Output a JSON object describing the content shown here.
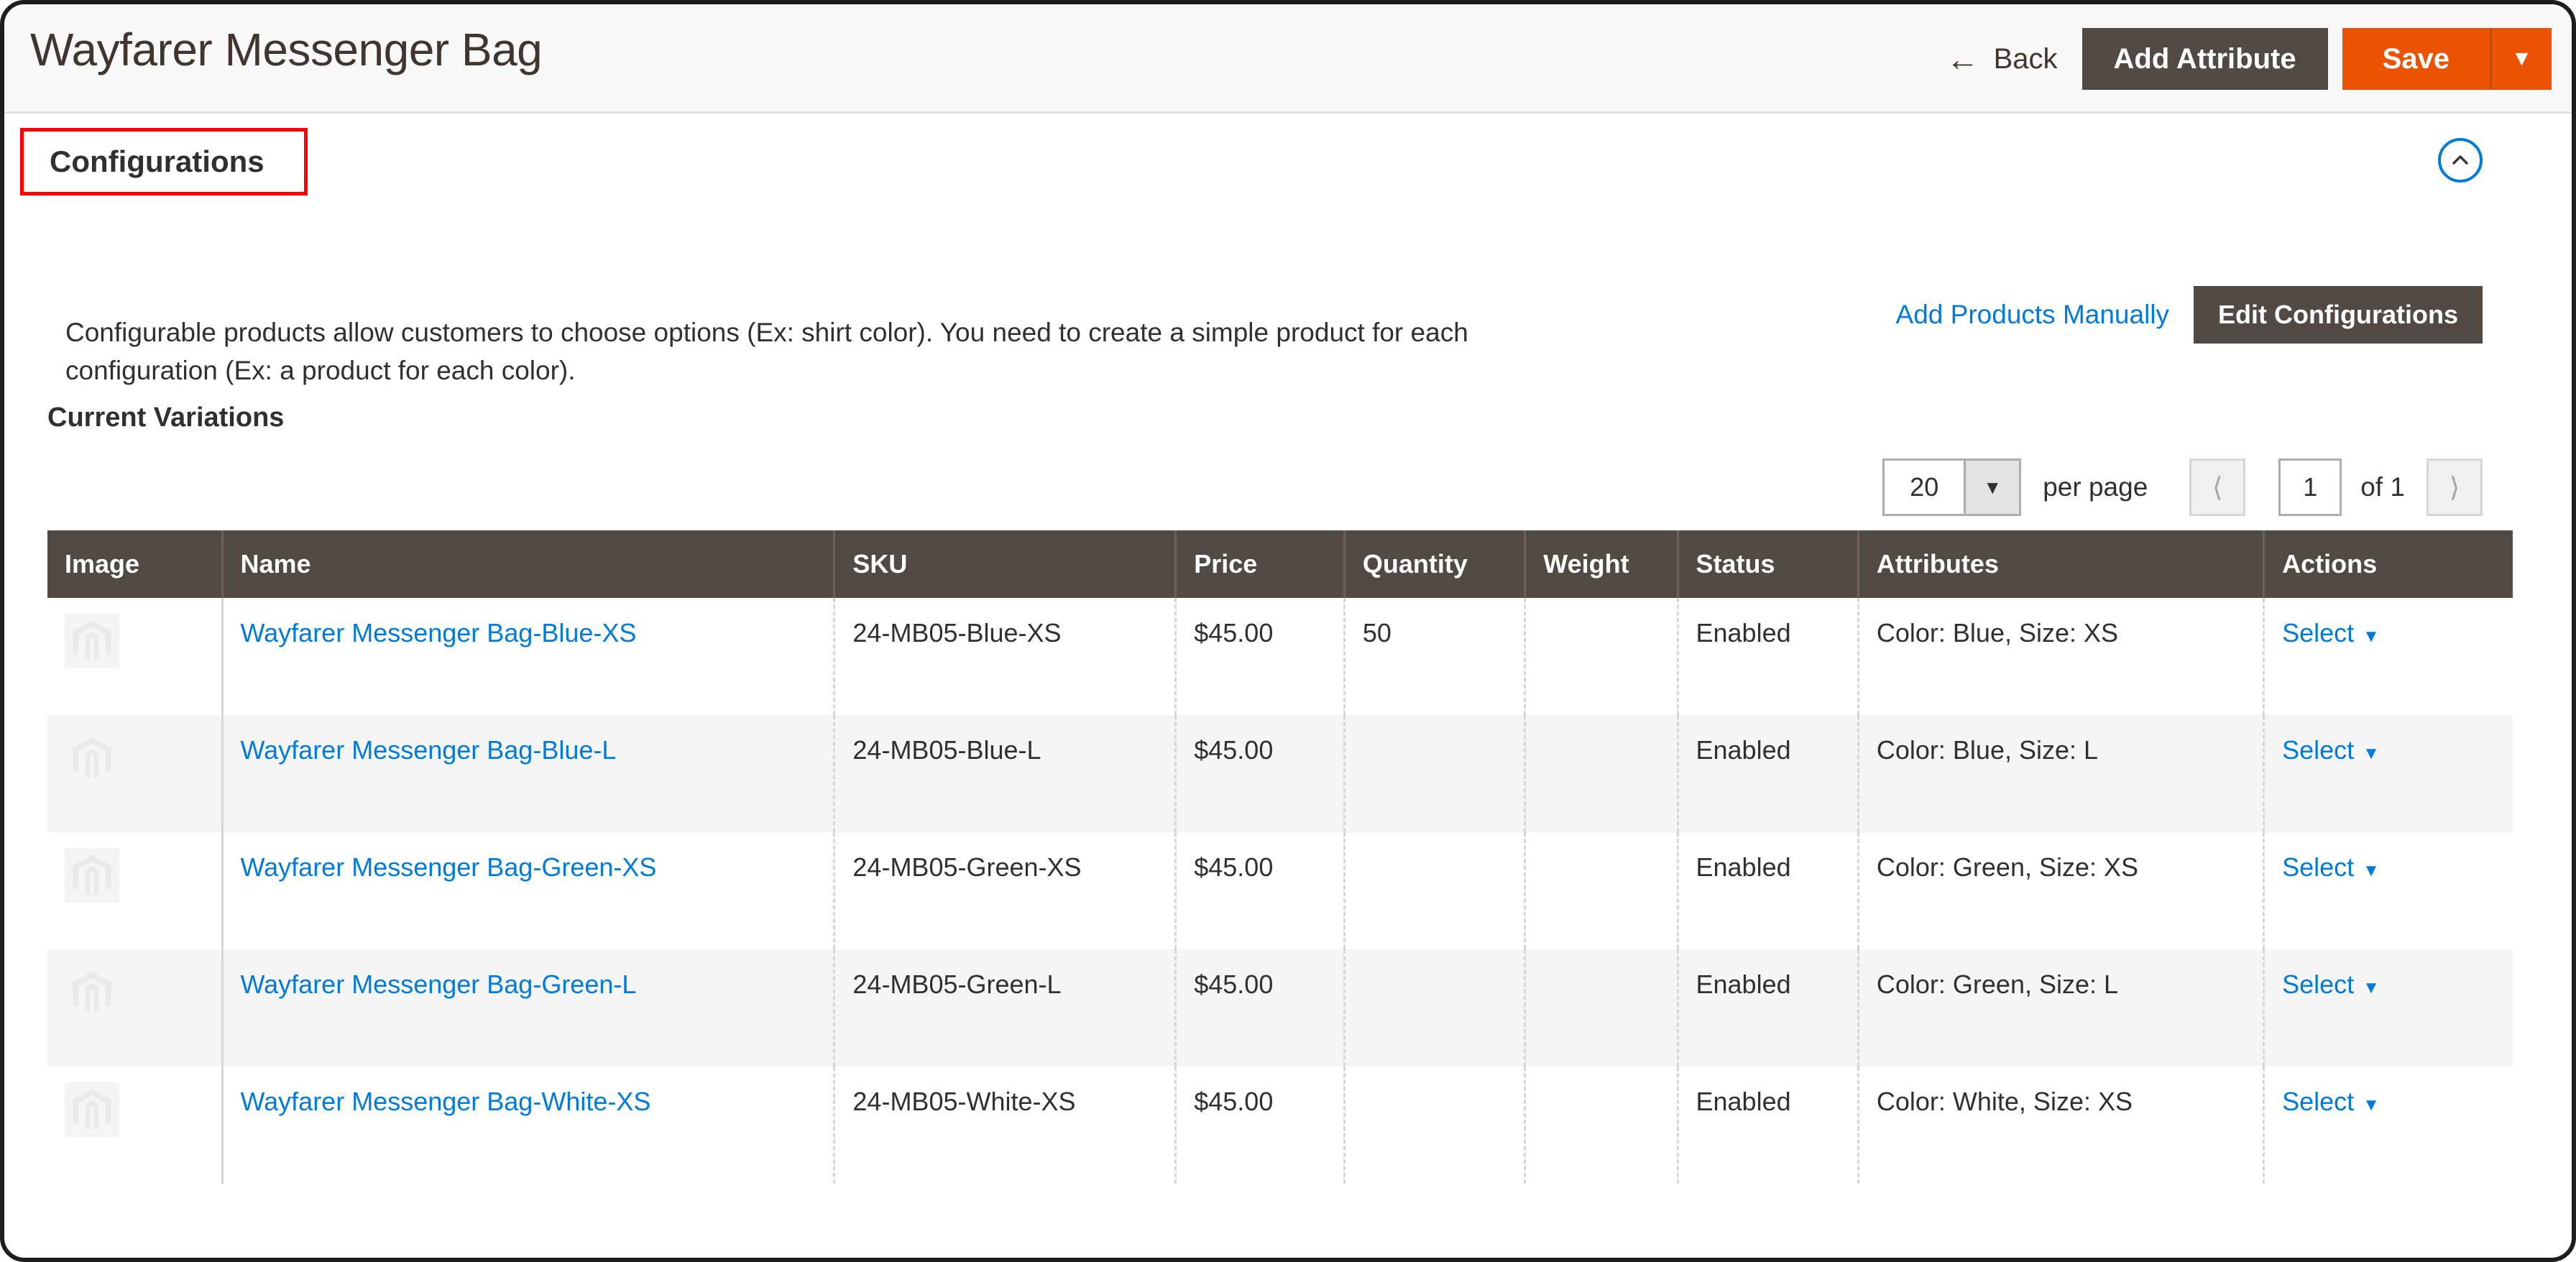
{
  "header": {
    "title": "Wayfarer Messenger Bag",
    "back_label": "Back",
    "back_icon": "arrow-left-icon",
    "add_attribute_label": "Add Attribute",
    "save_label": "Save",
    "save_dropdown_icon": "caret-down-icon"
  },
  "section": {
    "title": "Configurations",
    "collapse_icon": "chevron-up-circle-icon",
    "highlight_color": "#ff0000",
    "description": "Configurable products allow customers to choose options (Ex: shirt color). You need to create a simple product for each configuration (Ex: a product for each color).",
    "add_products_manually_label": "Add Products Manually",
    "edit_configurations_label": "Edit Configurations",
    "current_variations_label": "Current Variations"
  },
  "pagination": {
    "per_page_value": "20",
    "per_page_label": "per page",
    "prev_icon": "chevron-left-icon",
    "next_icon": "chevron-right-icon",
    "page_number": "1",
    "page_total": "of 1"
  },
  "table": {
    "columns": [
      "Image",
      "Name",
      "SKU",
      "Price",
      "Quantity",
      "Weight",
      "Status",
      "Attributes",
      "Actions"
    ],
    "rows": [
      {
        "image": "product-placeholder-icon",
        "name": "Wayfarer Messenger Bag-Blue-XS",
        "sku": "24-MB05-Blue-XS",
        "price": "$45.00",
        "quantity": "50",
        "weight": "",
        "status": "Enabled",
        "attributes": "Color: Blue, Size: XS",
        "action": "Select"
      },
      {
        "image": "product-placeholder-icon",
        "name": "Wayfarer Messenger Bag-Blue-L",
        "sku": "24-MB05-Blue-L",
        "price": "$45.00",
        "quantity": "",
        "weight": "",
        "status": "Enabled",
        "attributes": "Color: Blue, Size: L",
        "action": "Select"
      },
      {
        "image": "product-placeholder-icon",
        "name": "Wayfarer Messenger Bag-Green-XS",
        "sku": "24-MB05-Green-XS",
        "price": "$45.00",
        "quantity": "",
        "weight": "",
        "status": "Enabled",
        "attributes": "Color: Green, Size: XS",
        "action": "Select"
      },
      {
        "image": "product-placeholder-icon",
        "name": "Wayfarer Messenger Bag-Green-L",
        "sku": "24-MB05-Green-L",
        "price": "$45.00",
        "quantity": "",
        "weight": "",
        "status": "Enabled",
        "attributes": "Color: Green, Size: L",
        "action": "Select"
      },
      {
        "image": "product-placeholder-icon",
        "name": "Wayfarer Messenger Bag-White-XS",
        "sku": "24-MB05-White-XS",
        "price": "$45.00",
        "quantity": "",
        "weight": "",
        "status": "Enabled",
        "attributes": "Color: White, Size: XS",
        "action": "Select"
      }
    ]
  },
  "colors": {
    "brand_orange": "#eb5202",
    "dark_brown": "#514943",
    "link_blue": "#007bdb",
    "highlight_red": "#ff0000"
  }
}
